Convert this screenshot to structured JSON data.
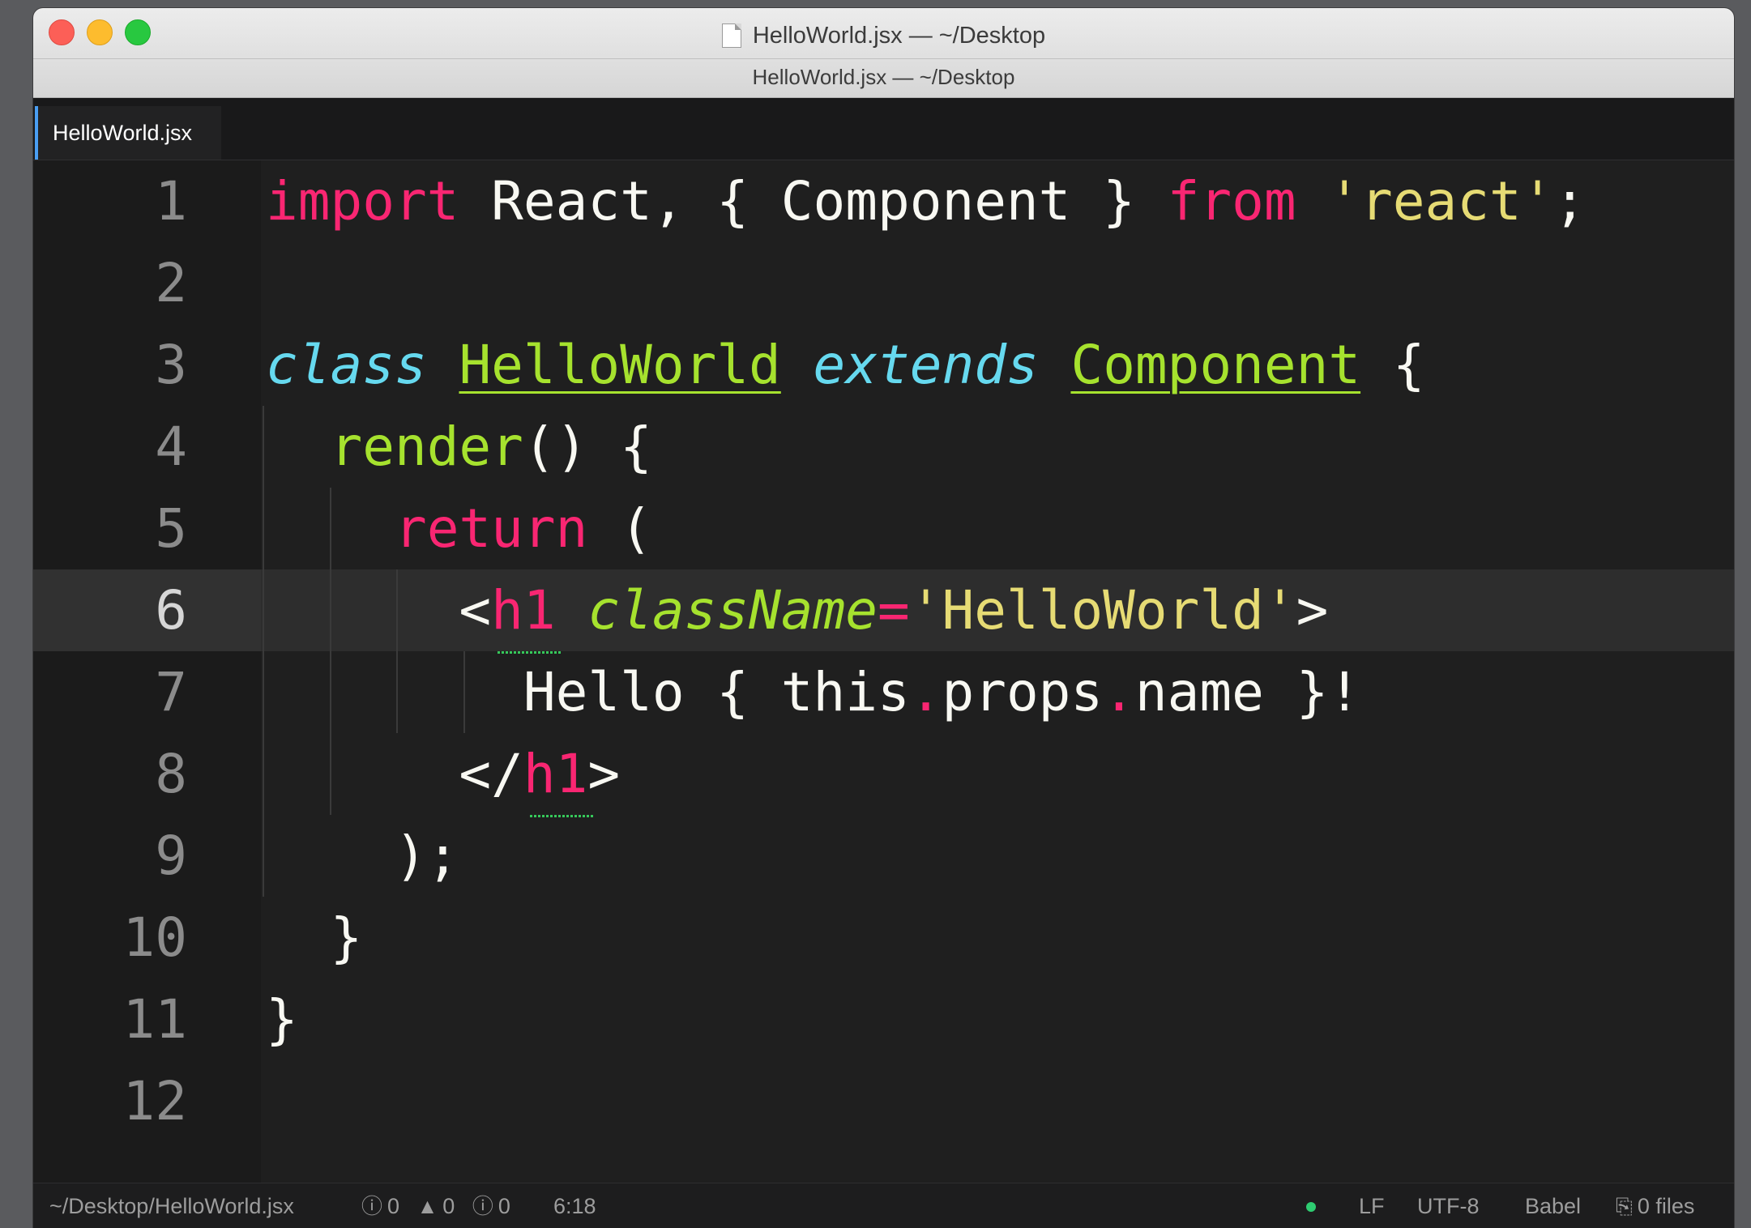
{
  "window": {
    "title": "HelloWorld.jsx — ~/Desktop",
    "subtitle": "HelloWorld.jsx — ~/Desktop"
  },
  "tabs": [
    {
      "label": "HelloWorld.jsx",
      "active": true
    }
  ],
  "editor": {
    "current_line": 6,
    "line_numbers": [
      "1",
      "2",
      "3",
      "4",
      "5",
      "6",
      "7",
      "8",
      "9",
      "10",
      "11",
      "12"
    ],
    "lines": [
      [
        {
          "t": "import",
          "c": "kw"
        },
        {
          "t": " React, { Component } "
        },
        {
          "t": "from",
          "c": "kw"
        },
        {
          "t": " "
        },
        {
          "t": "'react'",
          "c": "str"
        },
        {
          "t": ";"
        }
      ],
      [],
      [
        {
          "t": "class",
          "c": "it"
        },
        {
          "t": " "
        },
        {
          "t": "HelloWorld",
          "c": "cls"
        },
        {
          "t": " "
        },
        {
          "t": "extends",
          "c": "it"
        },
        {
          "t": " "
        },
        {
          "t": "Component",
          "c": "cls"
        },
        {
          "t": " {"
        }
      ],
      [
        {
          "t": "  "
        },
        {
          "t": "render",
          "c": "fn"
        },
        {
          "t": "() {"
        }
      ],
      [
        {
          "t": "    "
        },
        {
          "t": "return",
          "c": "kw"
        },
        {
          "t": " ("
        }
      ],
      [
        {
          "t": "      <"
        },
        {
          "t": "h1",
          "c": "pink"
        },
        {
          "t": " "
        },
        {
          "t": "className",
          "c": "attr"
        },
        {
          "t": "=",
          "c": "pink"
        },
        {
          "t": "'HelloWorld'",
          "c": "str"
        },
        {
          "t": ">"
        }
      ],
      [
        {
          "t": "        Hello { this"
        },
        {
          "t": ".",
          "c": "dot"
        },
        {
          "t": "props"
        },
        {
          "t": ".",
          "c": "dot"
        },
        {
          "t": "name }!"
        }
      ],
      [
        {
          "t": "      </"
        },
        {
          "t": "h1",
          "c": "pink"
        },
        {
          "t": ">"
        }
      ],
      [
        {
          "t": "    );"
        }
      ],
      [
        {
          "t": "  }"
        }
      ],
      [
        {
          "t": "}"
        }
      ],
      []
    ]
  },
  "status": {
    "file_path": "~/Desktop/HelloWorld.jsx",
    "errors": "0",
    "warnings": "0",
    "infos": "0",
    "cursor": "6:18",
    "line_ending": "LF",
    "encoding": "UTF-8",
    "grammar": "Babel",
    "files": "0 files"
  },
  "colors": {
    "keyword": "#f92672",
    "string": "#e6db74",
    "storage": "#66d9ef",
    "entity": "#a6e22e",
    "tab_accent": "#4a9ef2"
  },
  "icons": [
    "document-icon",
    "error-icon",
    "warning-icon",
    "info-icon",
    "git-status-dot-icon",
    "files-icon"
  ]
}
